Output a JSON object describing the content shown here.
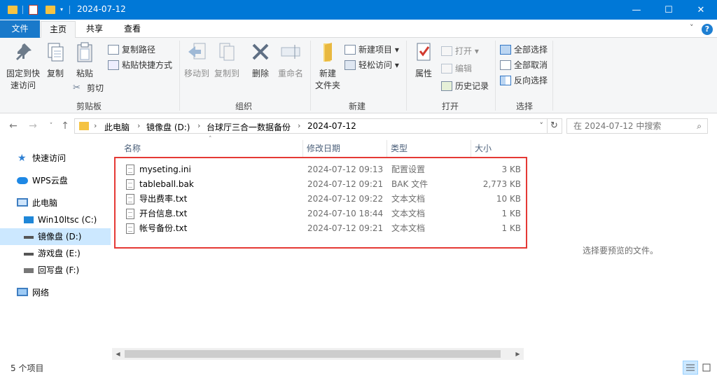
{
  "window": {
    "title": "2024-07-12",
    "minimize_glyph": "—",
    "maximize_glyph": "☐",
    "close_glyph": "✕"
  },
  "ribbon_tabs": {
    "file": "文件",
    "home": "主页",
    "share": "共享",
    "view": "查看",
    "collapse_glyph": "˅",
    "help_glyph": "?"
  },
  "ribbon": {
    "clipboard": {
      "label": "剪贴板",
      "pin": "固定到快\n速访问",
      "copy": "复制",
      "paste": "粘贴",
      "copy_path": "复制路径",
      "paste_shortcut": "粘贴快捷方式",
      "cut": "剪切"
    },
    "organize": {
      "label": "组织",
      "move_to": "移动到",
      "copy_to": "复制到",
      "delete": "删除",
      "rename": "重命名"
    },
    "new": {
      "label": "新建",
      "new_folder": "新建\n文件夹",
      "new_item": "新建项目",
      "easy_access": "轻松访问"
    },
    "open": {
      "label": "打开",
      "properties": "属性",
      "open": "打开",
      "edit": "编辑",
      "history": "历史记录"
    },
    "select": {
      "label": "选择",
      "select_all": "全部选择",
      "select_none": "全部取消",
      "invert": "反向选择"
    }
  },
  "address_bar": {
    "crumbs": [
      "此电脑",
      "镜像盘 (D:)",
      "台球厅三合一数据备份",
      "2024-07-12"
    ],
    "search_placeholder": "在 2024-07-12 中搜索"
  },
  "nav_pane": {
    "quick_access": "快速访问",
    "wps_cloud": "WPS云盘",
    "this_pc": "此电脑",
    "drives": [
      "Win10ltsc (C:)",
      "镜像盘 (D:)",
      "游戏盘 (E:)",
      "回写盘 (F:)"
    ],
    "network": "网络"
  },
  "file_list": {
    "columns": [
      "名称",
      "修改日期",
      "类型",
      "大小"
    ],
    "sort_indicator": "˄",
    "rows": [
      {
        "name": "myseting.ini",
        "date": "2024-07-12 09:13",
        "type": "配置设置",
        "size": "3 KB"
      },
      {
        "name": "tableball.bak",
        "date": "2024-07-12 09:21",
        "type": "BAK 文件",
        "size": "2,773 KB"
      },
      {
        "name": "导出费率.txt",
        "date": "2024-07-12 09:22",
        "type": "文本文档",
        "size": "10 KB"
      },
      {
        "name": "开台信息.txt",
        "date": "2024-07-10 18:44",
        "type": "文本文档",
        "size": "1 KB"
      },
      {
        "name": "帐号备份.txt",
        "date": "2024-07-12 09:21",
        "type": "文本文档",
        "size": "1 KB"
      }
    ]
  },
  "preview": {
    "message": "选择要预览的文件。"
  },
  "status_bar": {
    "item_count": "5 个项目"
  },
  "colors": {
    "accent": "#0078d7",
    "highlight_border": "#e53935",
    "selection": "#cce8ff"
  }
}
